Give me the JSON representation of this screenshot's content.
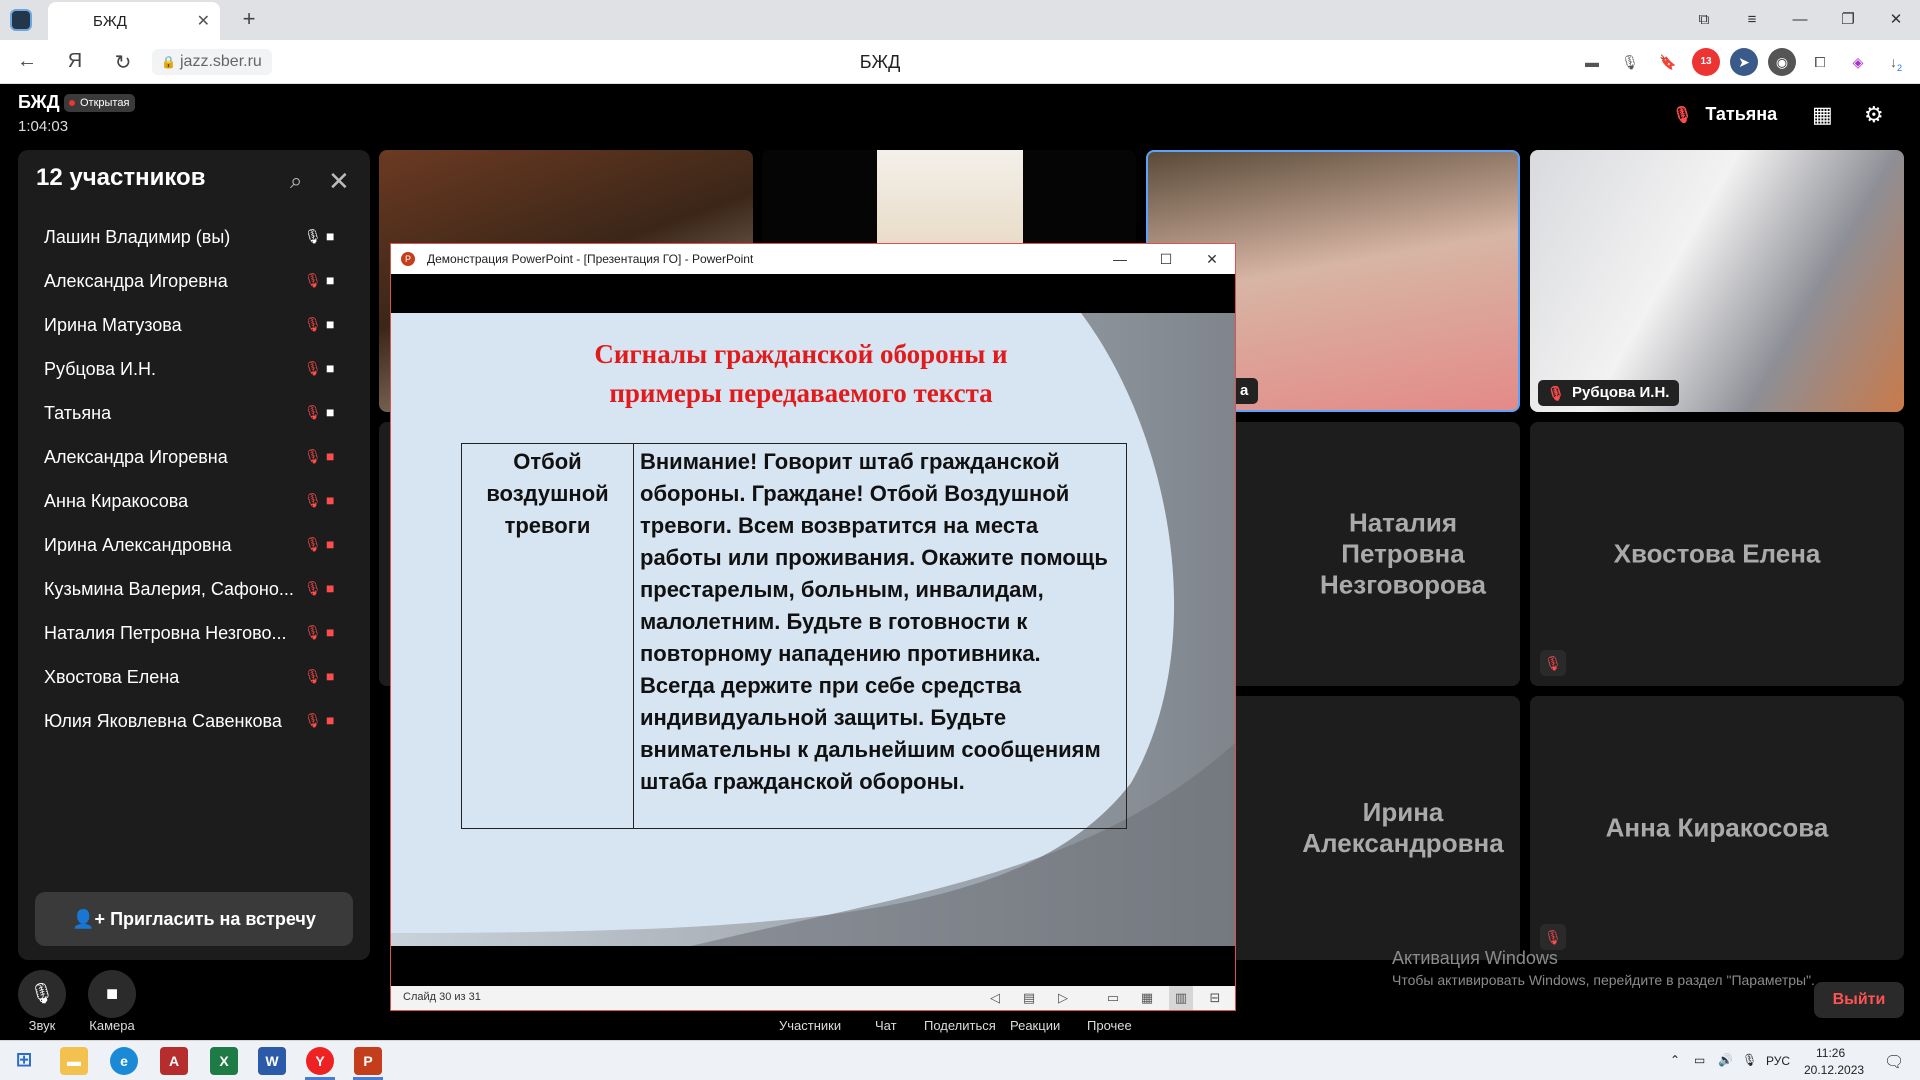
{
  "browser": {
    "tab_title": "БЖД",
    "url": "jazz.sber.ru",
    "page_title": "БЖД",
    "notif_count": "13",
    "downloads_count": "2"
  },
  "meeting": {
    "title": "БЖД",
    "badge": "Открытая",
    "elapsed": "1:04:03",
    "active_speaker": "Татьяна"
  },
  "sidebar": {
    "title": "12 участников",
    "participants": [
      {
        "name": "Лашин Владимир (вы)",
        "mic": "on",
        "cam": "on"
      },
      {
        "name": "Александра Игоревна",
        "mic": "off",
        "cam": "on"
      },
      {
        "name": "Ирина Матузова",
        "mic": "off",
        "cam": "on"
      },
      {
        "name": "Рубцова И.Н.",
        "mic": "off",
        "cam": "on"
      },
      {
        "name": "Татьяна",
        "mic": "off",
        "cam": "on"
      },
      {
        "name": "Александра Игоревна",
        "mic": "off",
        "cam": "off"
      },
      {
        "name": "Анна Киракосова",
        "mic": "off",
        "cam": "off"
      },
      {
        "name": "Ирина Александровна",
        "mic": "off",
        "cam": "off"
      },
      {
        "name": "Кузьмина Валерия, Сафоно...",
        "mic": "off",
        "cam": "off"
      },
      {
        "name": "Наталия Петровна Незгово...",
        "mic": "off",
        "cam": "off"
      },
      {
        "name": "Хвостова Елена",
        "mic": "off",
        "cam": "off"
      },
      {
        "name": "Юлия Яковлевна Савенкова",
        "mic": "off",
        "cam": "off"
      }
    ],
    "invite_label": "Пригласить на встречу"
  },
  "tiles": {
    "partial_label": "а",
    "rubtsova_label": "Рубцова И.Н.",
    "natalia": "Наталия Петровна Незговорова",
    "khvostova": "Хвостова Елена",
    "irina": "Ирина Александровна",
    "anna": "Анна Киракосова"
  },
  "powerpoint": {
    "window_title": "Демонстрация PowerPoint - [Презентация ГО] - PowerPoint",
    "slide_heading_line1": "Сигналы гражданской обороны и",
    "slide_heading_line2": "примеры передаваемого текста",
    "table_left_1": "Отбой",
    "table_left_2": "воздушной",
    "table_left_3": "тревоги",
    "table_right": "Внимание! Говорит штаб гражданской обороны. Граждане! Отбой Воздушной тревоги. Всем возвратится на места работы или проживания. Окажите помощь престарелым, больным, инвалидам, малолетним. Будьте в готовности к повторному нападению противника. Всегда держите при себе средства индивидуальной защиты. Будьте внимательны к дальнейшим сообщениям штаба гражданской обороны.",
    "slide_counter": "Слайд 30 из 31"
  },
  "controls": {
    "sound": "Звук",
    "camera": "Камера",
    "participants": "Участники",
    "chat": "Чат",
    "share": "Поделиться",
    "reactions": "Реакции",
    "more": "Прочее",
    "leave": "Выйти"
  },
  "watermark": {
    "line1": "Активация Windows",
    "line2": "Чтобы активировать Windows, перейдите в раздел \"Параметры\"."
  },
  "taskbar": {
    "lang": "РУС",
    "time": "11:26",
    "date": "20.12.2023"
  }
}
